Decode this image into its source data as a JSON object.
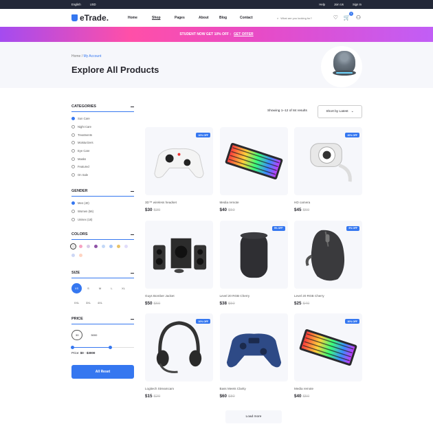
{
  "topbar": {
    "language": "English",
    "currency": "USD",
    "help": "Help",
    "join": "Join Us",
    "signin": "Sign In"
  },
  "header": {
    "logo": "eTrade.",
    "nav": [
      "Home",
      "Shop",
      "Pages",
      "About",
      "Blog",
      "Contact"
    ],
    "search_placeholder": "What are you looking for?",
    "cart_count": "0"
  },
  "promo": {
    "text": "STUDENT NOW GET 10% OFF :",
    "link": "GET OFFER"
  },
  "hero": {
    "breadcrumb_home": "Home",
    "breadcrumb_sep": "/",
    "breadcrumb_current": "My Account",
    "title": "Explore All Products"
  },
  "filters": {
    "categories": {
      "title": "CATEGORIES",
      "items": [
        "Sun Care",
        "Night Care",
        "Treatments",
        "Moisturizers",
        "Eye Care",
        "Masks",
        "Featured",
        "On Sale"
      ]
    },
    "gender": {
      "title": "GENDER",
      "items": [
        "Men (40)",
        "Women (56)",
        "Unisex (18)"
      ]
    },
    "colors": {
      "title": "COLORS",
      "swatches": [
        "#e7e7e7",
        "#f7a3c3",
        "#d8cbe9",
        "#8e52a6",
        "#c3d8f7",
        "#a7c5f8",
        "#e8c268",
        "#e0dcfa",
        "#ccd7f5",
        "#ffd4c2"
      ]
    },
    "size": {
      "title": "SIZE",
      "items": [
        "XS",
        "S",
        "M",
        "L",
        "XL",
        "XXL",
        "3XL",
        "4XL"
      ]
    },
    "price": {
      "title": "PRICE",
      "min": "30",
      "max": "5000",
      "range_label": "Price:",
      "range_from": "$0",
      "range_sep": "-",
      "range_to": "$3000"
    },
    "reset": "All Reset"
  },
  "toolbar": {
    "showing": "Showing 1–12 of 84 results",
    "sort": "Short by Latest"
  },
  "products": [
    {
      "name": "3D™ wireless headset",
      "price": "$30",
      "old": "$30",
      "off": "10% OFF",
      "img": "gamepad-white"
    },
    {
      "name": "Media remote",
      "price": "$40",
      "old": "$50",
      "off": "",
      "img": "keyboard"
    },
    {
      "name": "HD camera",
      "price": "$45",
      "old": "$60",
      "off": "20% OFF",
      "img": "webcam"
    },
    {
      "name": "Guys Bomber Jacket",
      "price": "$50",
      "old": "$60",
      "off": "",
      "img": "speakers"
    },
    {
      "name": "Level 20 RGB Cherry",
      "price": "$38",
      "old": "$50",
      "off": "5% OFF",
      "img": "smart-speaker"
    },
    {
      "name": "Level 20 RGB Cherry",
      "price": "$25",
      "old": "$40",
      "off": "5% OFF",
      "img": "mouse"
    },
    {
      "name": "Logitech Streamcam",
      "price": "$15",
      "old": "$20",
      "off": "10% OFF",
      "img": "headset"
    },
    {
      "name": "Bass Meets Clarity",
      "price": "$60",
      "old": "$80",
      "off": "",
      "img": "gamepad-blue"
    },
    {
      "name": "Media remote",
      "price": "$40",
      "old": "$50",
      "off": "30% OFF",
      "img": "keyboard"
    }
  ],
  "load_more": "Load more"
}
